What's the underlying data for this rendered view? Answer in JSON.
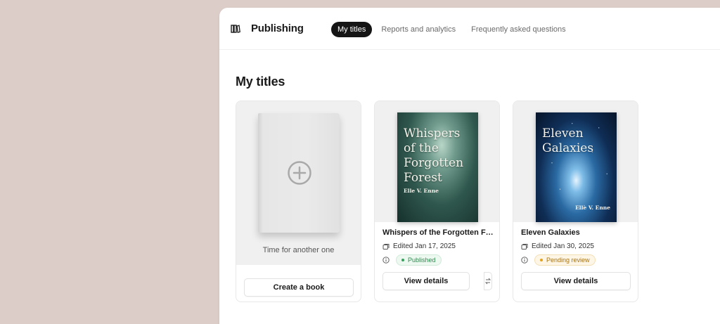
{
  "app": {
    "title": "Publishing",
    "icon": "books-icon"
  },
  "nav": {
    "tabs": [
      {
        "label": "My titles",
        "active": true
      },
      {
        "label": "Reports and analytics",
        "active": false
      },
      {
        "label": "Frequently asked questions",
        "active": false
      }
    ]
  },
  "main": {
    "title": "My titles",
    "create_card": {
      "caption": "Time for another one",
      "button_label": "Create a book",
      "icon": "plus-circle-icon"
    },
    "books": [
      {
        "cover_title": "Whispers of the Forgotten Forest",
        "cover_author": "Elle V. Enne",
        "name": "Whispers of the Forgotten Fo...",
        "edited": "Edited Jan 17, 2025",
        "status": "Published",
        "status_color": "#35a25c",
        "button_label": "View details"
      },
      {
        "cover_title": "Eleven Galaxies",
        "cover_author": "Elle V. Enne",
        "name": "Eleven Galaxies",
        "edited": "Edited Jan 30, 2025",
        "status": "Pending review",
        "status_color": "#e3a21a",
        "button_label": "View details"
      }
    ]
  },
  "colors": {
    "background": "#dccdc8",
    "active_tab": "#151515"
  }
}
